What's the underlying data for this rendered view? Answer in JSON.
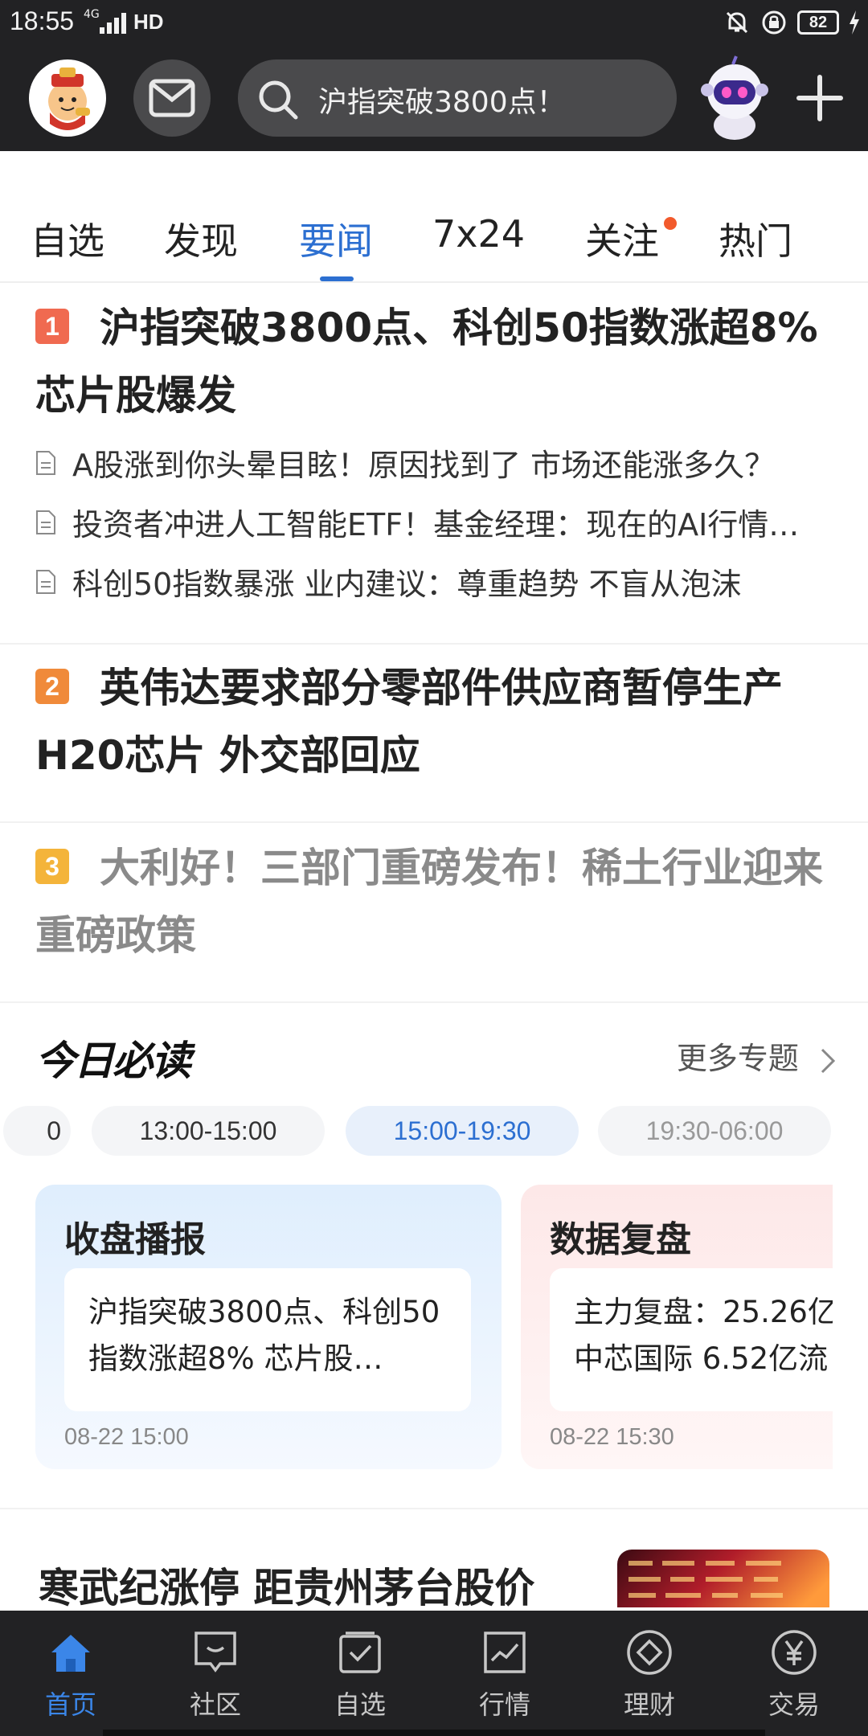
{
  "status_bar": {
    "time": "18:55",
    "network": "4G",
    "hd": "HD",
    "battery": "82"
  },
  "header": {
    "search_text": "沪指突破3800点！"
  },
  "tabs": [
    "自选",
    "发现",
    "要闻",
    "7x24",
    "关注",
    "热门"
  ],
  "news": [
    {
      "rank": "1",
      "title": "沪指突破3800点、科创50指数涨超8% 芯片股爆发",
      "subs": [
        "A股涨到你头晕目眩！原因找到了 市场还能涨多久？",
        "投资者冲进人工智能ETF！基金经理：现在的AI行情…",
        "科创50指数暴涨 业内建议：尊重趋势 不盲从泡沫"
      ]
    },
    {
      "rank": "2",
      "title": "英伟达要求部分零部件供应商暂停生产H20芯片 外交部回应"
    },
    {
      "rank": "3",
      "title": "大利好！三部门重磅发布！稀土行业迎来重磅政策"
    }
  ],
  "today": {
    "title": "今日必读",
    "more": "更多专题",
    "chips": [
      "0",
      "13:00-15:00",
      "15:00-19:30",
      "19:30-06:00"
    ],
    "cards": [
      {
        "title": "收盘播报",
        "text": "沪指突破3800点、科创50指数涨超8% 芯片股…",
        "time": "08-22 15:00"
      },
      {
        "title": "数据复盘",
        "text": "主力复盘：25.26亿 中芯国际 6.52亿流",
        "time": "08-22 15:30"
      }
    ]
  },
  "bottom_headline": "寒武纪涨停 距贵州茅台股价",
  "bottom_nav": [
    "首页",
    "社区",
    "自选",
    "行情",
    "理财",
    "交易"
  ],
  "colors": {
    "accent": "#2c6fd1",
    "rank1": "#f06a50",
    "rank2": "#f08a3a",
    "rank3": "#f4b43a"
  }
}
